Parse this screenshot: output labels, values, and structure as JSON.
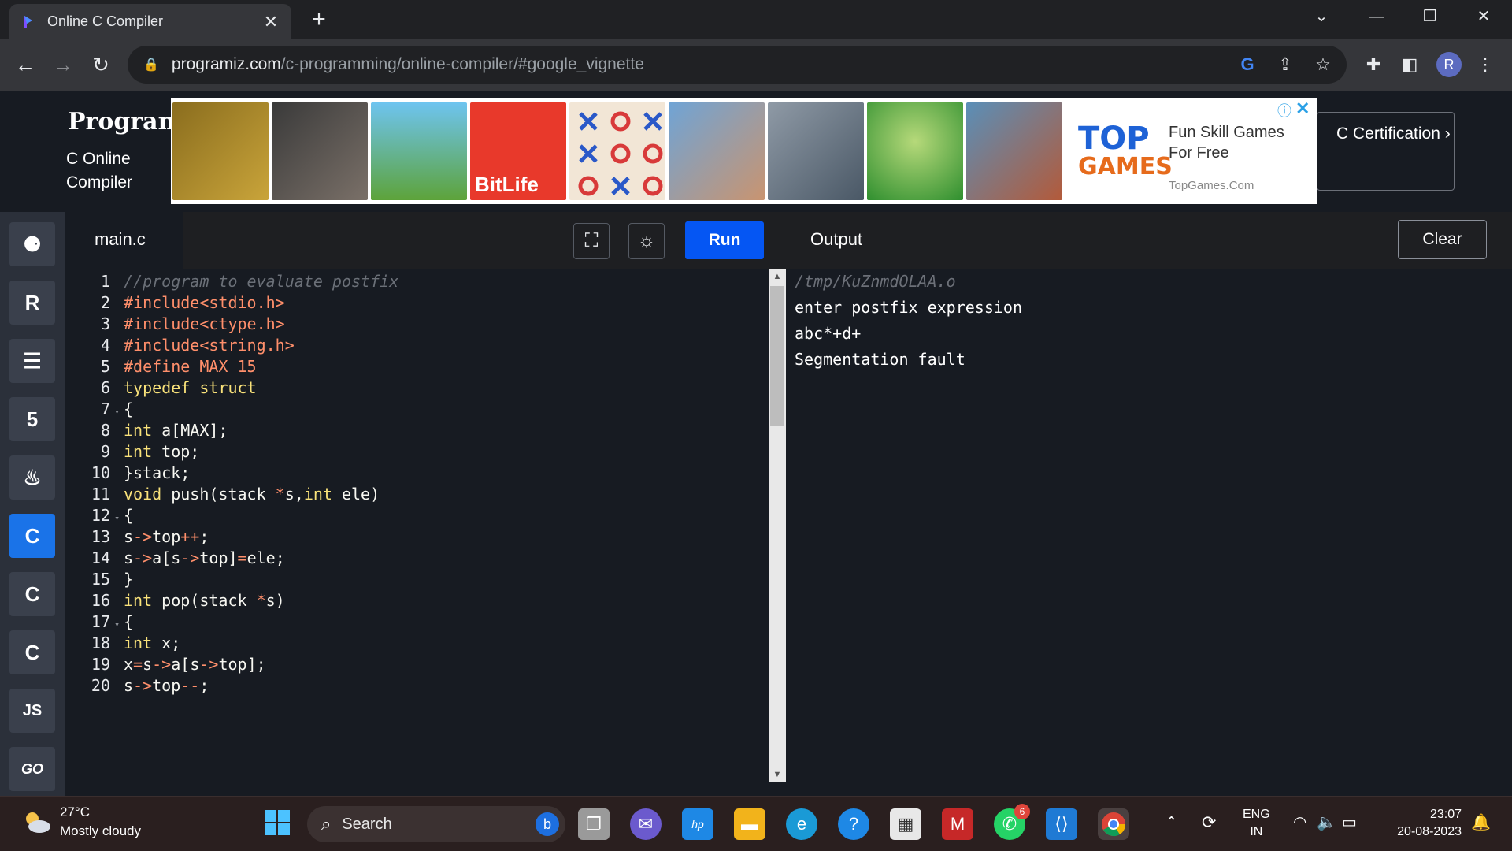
{
  "browser": {
    "tab_title": "Online C Compiler",
    "url_host": "programiz.com",
    "url_path": "/c-programming/online-compiler/#google_vignette",
    "profile_initial": "R"
  },
  "site": {
    "logo": "Programiz",
    "subtitle": "C Online Compiler",
    "cert_button": "C Certification ›"
  },
  "ad": {
    "brand_top": "TOP",
    "brand_bottom": "GAMES",
    "tagline": "Fun Skill Games For Free",
    "domain": "TopGames.Com",
    "thumb_labels": [
      "",
      "",
      "",
      "BitLife",
      "",
      "",
      "",
      "",
      ""
    ]
  },
  "languages": [
    "python",
    "r",
    "sql",
    "html",
    "java",
    "c",
    "cpp",
    "csharp",
    "javascript",
    "go"
  ],
  "lang_labels": {
    "javascript": "JS",
    "go": "GO"
  },
  "editor": {
    "filename": "main.c",
    "run_label": "Run",
    "lines": [
      {
        "n": "1",
        "fold": false,
        "segments": [
          {
            "t": "//program to evaluate postfix",
            "c": "#6b7078",
            "i": true
          }
        ]
      },
      {
        "n": "2",
        "fold": false,
        "segments": [
          {
            "t": "#include",
            "c": "#ff8f6b"
          },
          {
            "t": "<stdio.h>",
            "c": "#ff8f6b"
          }
        ]
      },
      {
        "n": "3",
        "fold": false,
        "segments": [
          {
            "t": "#include",
            "c": "#ff8f6b"
          },
          {
            "t": "<ctype.h>",
            "c": "#ff8f6b"
          }
        ]
      },
      {
        "n": "4",
        "fold": false,
        "segments": [
          {
            "t": "#include",
            "c": "#ff8f6b"
          },
          {
            "t": "<string.h>",
            "c": "#ff8f6b"
          }
        ]
      },
      {
        "n": "5",
        "fold": false,
        "segments": [
          {
            "t": "#define ",
            "c": "#ff8f6b"
          },
          {
            "t": "MAX 15",
            "c": "#ff8f6b"
          }
        ]
      },
      {
        "n": "6",
        "fold": false,
        "segments": [
          {
            "t": "typedef struct",
            "c": "#f9e27a"
          }
        ]
      },
      {
        "n": "7",
        "fold": true,
        "segments": [
          {
            "t": "{",
            "c": "#f8f8f2"
          }
        ]
      },
      {
        "n": "8",
        "fold": false,
        "segments": [
          {
            "t": "int",
            "c": "#f9e27a"
          },
          {
            "t": " a[MAX];",
            "c": "#f8f8f2"
          }
        ]
      },
      {
        "n": "9",
        "fold": false,
        "segments": [
          {
            "t": "int",
            "c": "#f9e27a"
          },
          {
            "t": " top;",
            "c": "#f8f8f2"
          }
        ]
      },
      {
        "n": "10",
        "fold": false,
        "segments": [
          {
            "t": "}stack;",
            "c": "#f8f8f2"
          }
        ]
      },
      {
        "n": "11",
        "fold": false,
        "segments": [
          {
            "t": "void",
            "c": "#f9e27a"
          },
          {
            "t": " push(stack ",
            "c": "#f8f8f2"
          },
          {
            "t": "*",
            "c": "#ff8f6b"
          },
          {
            "t": "s,",
            "c": "#f8f8f2"
          },
          {
            "t": "int",
            "c": "#f9e27a"
          },
          {
            "t": " ele)",
            "c": "#f8f8f2"
          }
        ]
      },
      {
        "n": "12",
        "fold": true,
        "segments": [
          {
            "t": "{",
            "c": "#f8f8f2"
          }
        ]
      },
      {
        "n": "13",
        "fold": false,
        "segments": [
          {
            "t": "s",
            "c": "#f8f8f2"
          },
          {
            "t": "->",
            "c": "#ff8f6b"
          },
          {
            "t": "top",
            "c": "#f8f8f2"
          },
          {
            "t": "++",
            "c": "#ff8f6b"
          },
          {
            "t": ";",
            "c": "#f8f8f2"
          }
        ]
      },
      {
        "n": "14",
        "fold": false,
        "segments": [
          {
            "t": "s",
            "c": "#f8f8f2"
          },
          {
            "t": "->",
            "c": "#ff8f6b"
          },
          {
            "t": "a[s",
            "c": "#f8f8f2"
          },
          {
            "t": "->",
            "c": "#ff8f6b"
          },
          {
            "t": "top]",
            "c": "#f8f8f2"
          },
          {
            "t": "=",
            "c": "#ff8f6b"
          },
          {
            "t": "ele;",
            "c": "#f8f8f2"
          }
        ]
      },
      {
        "n": "15",
        "fold": false,
        "segments": [
          {
            "t": "}",
            "c": "#f8f8f2"
          }
        ]
      },
      {
        "n": "16",
        "fold": false,
        "segments": [
          {
            "t": "int",
            "c": "#f9e27a"
          },
          {
            "t": " pop(stack ",
            "c": "#f8f8f2"
          },
          {
            "t": "*",
            "c": "#ff8f6b"
          },
          {
            "t": "s)",
            "c": "#f8f8f2"
          }
        ]
      },
      {
        "n": "17",
        "fold": true,
        "segments": [
          {
            "t": "{",
            "c": "#f8f8f2"
          }
        ]
      },
      {
        "n": "18",
        "fold": false,
        "segments": [
          {
            "t": "int",
            "c": "#f9e27a"
          },
          {
            "t": " x;",
            "c": "#f8f8f2"
          }
        ]
      },
      {
        "n": "19",
        "fold": false,
        "segments": [
          {
            "t": "x",
            "c": "#f8f8f2"
          },
          {
            "t": "=",
            "c": "#ff8f6b"
          },
          {
            "t": "s",
            "c": "#f8f8f2"
          },
          {
            "t": "->",
            "c": "#ff8f6b"
          },
          {
            "t": "a[s",
            "c": "#f8f8f2"
          },
          {
            "t": "->",
            "c": "#ff8f6b"
          },
          {
            "t": "top];",
            "c": "#f8f8f2"
          }
        ]
      },
      {
        "n": "20",
        "fold": false,
        "segments": [
          {
            "t": "s",
            "c": "#f8f8f2"
          },
          {
            "t": "->",
            "c": "#ff8f6b"
          },
          {
            "t": "top",
            "c": "#f8f8f2"
          },
          {
            "t": "--",
            "c": "#ff8f6b"
          },
          {
            "t": ";",
            "c": "#f8f8f2"
          }
        ]
      }
    ]
  },
  "output": {
    "title": "Output",
    "clear_label": "Clear",
    "lines": [
      "/tmp/KuZnmdOLAA.o",
      "enter postfix expression",
      "abc*+d+",
      "Segmentation fault"
    ]
  },
  "taskbar": {
    "temperature": "27°C",
    "weather": "Mostly cloudy",
    "search_placeholder": "Search",
    "whatsapp_badge": "6",
    "language_line1": "ENG",
    "language_line2": "IN",
    "time": "23:07",
    "date": "20-08-2023"
  }
}
